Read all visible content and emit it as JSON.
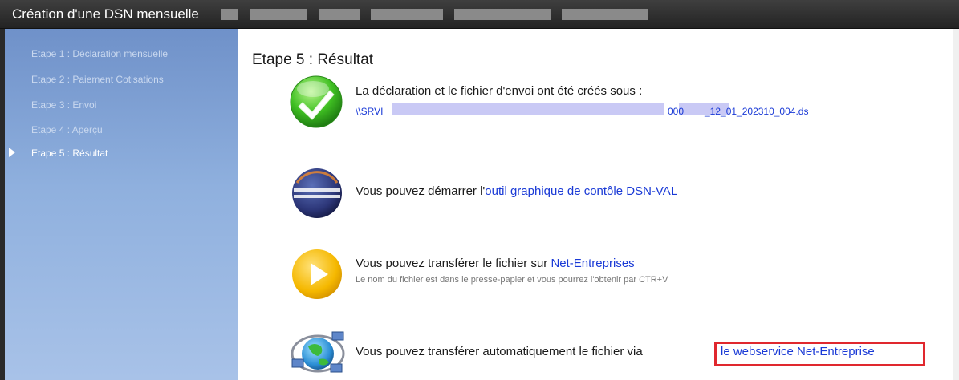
{
  "window": {
    "title": "Création d'une DSN mensuelle"
  },
  "sidebar": {
    "steps": [
      {
        "label": "Etape 1 : Déclaration mensuelle"
      },
      {
        "label": "Etape 2 : Paiement Cotisations"
      },
      {
        "label": "Etape 3 : Envoi"
      },
      {
        "label": "Etape 4 : Aperçu"
      },
      {
        "label": "Etape 5 : Résultat"
      }
    ],
    "active_index": 4
  },
  "main": {
    "title": "Etape 5 : Résultat",
    "result": {
      "message": "La déclaration et le fichier d'envoi ont été créés sous :",
      "path_start": "\\\\SRVI",
      "path_mid": "000",
      "path_end": "_12_01_202310_004.ds"
    },
    "dsnval": {
      "text": "Vous pouvez démarrer l'",
      "link": "outil graphique de contôle DSN-VAL"
    },
    "transfer": {
      "text": "Vous pouvez transférer le fichier sur ",
      "link": "Net-Entreprises",
      "note": "Le nom du fichier est dans le presse-papier et vous pourrez l'obtenir par CTR+V"
    },
    "webservice": {
      "text": "Vous pouvez transférer automatiquement le fichier via",
      "link": "le webservice Net-Entreprise"
    }
  },
  "icons": [
    "checkmark-icon",
    "eclipse-icon",
    "play-icon",
    "globe-network-icon",
    "chevron-right-icon"
  ],
  "colors": {
    "link": "#1a3ad6",
    "highlight": "#e0282e",
    "sidebar": "#8fb0de"
  }
}
